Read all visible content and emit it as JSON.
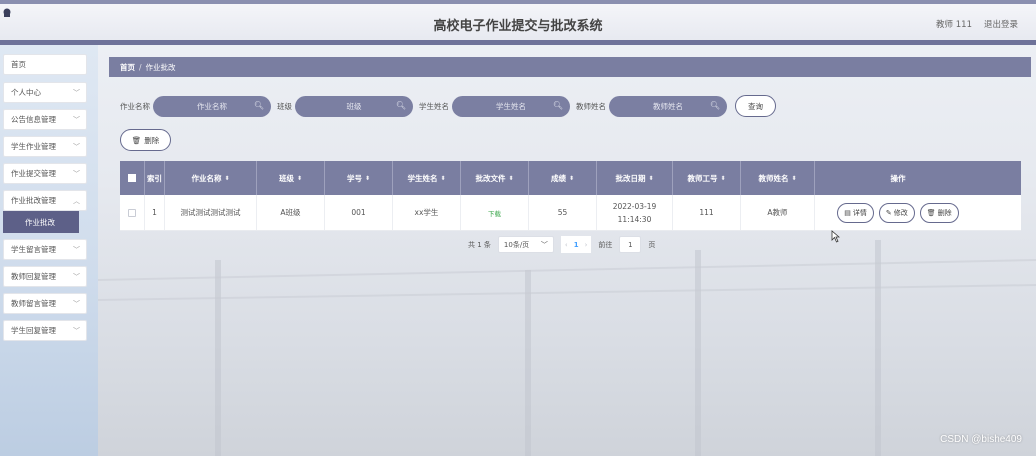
{
  "header": {
    "title": "高校电子作业提交与批改系统",
    "user": "教师 111",
    "logout": "退出登录"
  },
  "sidebar": {
    "items": [
      {
        "label": "首页"
      },
      {
        "label": "个人中心"
      },
      {
        "label": "公告信息管理"
      },
      {
        "label": "学生作业管理"
      },
      {
        "label": "作业提交管理"
      },
      {
        "label": "作业批改管理"
      },
      {
        "label": "学生留言管理"
      },
      {
        "label": "教师回复管理"
      },
      {
        "label": "教师留言管理"
      },
      {
        "label": "学生回复管理"
      }
    ],
    "active_sub": "作业批改"
  },
  "breadcrumb": {
    "home": "首页",
    "sep": "/",
    "current": "作业批改"
  },
  "search": {
    "fields": [
      {
        "label": "作业名称",
        "placeholder": "作业名称"
      },
      {
        "label": "班级",
        "placeholder": "班级"
      },
      {
        "label": "学生姓名",
        "placeholder": "学生姓名"
      },
      {
        "label": "教师姓名",
        "placeholder": "教师姓名"
      }
    ],
    "search_button": "查询"
  },
  "actions": {
    "delete_button": "删除"
  },
  "table": {
    "headers": [
      "索引",
      "作业名称",
      "班级",
      "学号",
      "学生姓名",
      "批改文件",
      "成绩",
      "批改日期",
      "教师工号",
      "教师姓名",
      "操作"
    ],
    "rows": [
      {
        "index": "1",
        "name": "测试测试测试测试",
        "class": "A班级",
        "student_no": "001",
        "student_name": "xx学生",
        "file": "下载",
        "score": "55",
        "date": "2022-03-19 11:14:30",
        "teacher_no": "111",
        "teacher_name": "A教师",
        "ops": [
          "详情",
          "修改",
          "删除"
        ]
      }
    ]
  },
  "pagination": {
    "total": "共 1 条",
    "page_size": "10条/页",
    "current_page": "1",
    "goto_label": "前往",
    "goto_value": "1",
    "page_suffix": "页"
  },
  "watermark": "CSDN @bishe409",
  "colors": {
    "primary": "#7a7ea1",
    "active": "#5d6088",
    "download": "#3aa64a",
    "page_active": "#409eff"
  }
}
